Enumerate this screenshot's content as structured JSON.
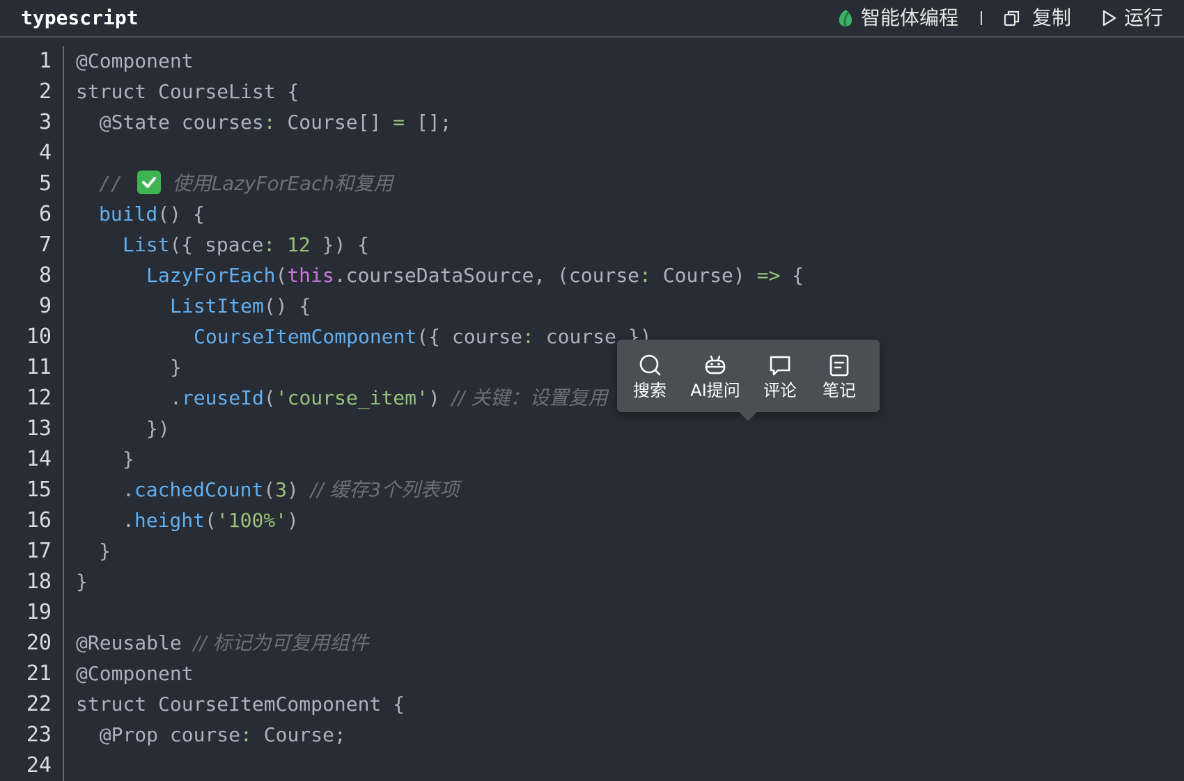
{
  "header": {
    "language": "typescript",
    "actions": [
      {
        "label": "智能体编程",
        "icon": "agent-logo-icon"
      },
      {
        "label": "复制",
        "icon": "copy-icon"
      },
      {
        "label": "运行",
        "icon": "play-icon"
      }
    ]
  },
  "editor": {
    "line_numbers": [
      "1",
      "2",
      "3",
      "4",
      "5",
      "6",
      "7",
      "8",
      "9",
      "10",
      "11",
      "12",
      "13",
      "14",
      "15",
      "16",
      "17",
      "18",
      "19",
      "20",
      "21",
      "22",
      "23",
      "24"
    ],
    "code": {
      "l1": "@Component",
      "l2": "struct CourseList {",
      "l3_a": "  @State courses",
      "l3_b": ":",
      "l3_c": " Course[] ",
      "l3_d": "=",
      "l3_e": " [];",
      "l5_a": "// ",
      "l5_b": " 使用LazyForEach和复用",
      "l6_a": "build",
      "l6_b": "() {",
      "l7_a": "List",
      "l7_b": "({ space",
      "l7_c": ":",
      "l7_d": "12",
      "l7_e": " }) {",
      "l8_a": "LazyForEach",
      "l8_b": "(",
      "l8_c": "this",
      "l8_d": ".courseDataSource, (course",
      "l8_e": ":",
      "l8_f": " Course) ",
      "l8_g": "=>",
      "l8_h": " {",
      "l9_a": "ListItem",
      "l9_b": "() {",
      "l10_a": "CourseItemComponent",
      "l10_b": "({ course",
      "l10_c": ":",
      "l10_d": " course })",
      "l11": "}",
      "l12_a": ".",
      "l12_b": "reuseId",
      "l12_c": "(",
      "l12_d": "'course_item'",
      "l12_e": ") ",
      "l12_f": "// 关键：设置复用",
      "l13": "})",
      "l14": "}",
      "l15_a": ".",
      "l15_b": "cachedCount",
      "l15_c": "(",
      "l15_d": "3",
      "l15_e": ") ",
      "l15_f": "// 缓存3个列表项",
      "l16_a": ".",
      "l16_b": "height",
      "l16_c": "(",
      "l16_d": "'100%'",
      "l16_e": ")",
      "l17": "}",
      "l18": "}",
      "l20_a": "@Reusable ",
      "l20_b": "// 标记为可复用组件",
      "l21": "@Component",
      "l22": "struct CourseItemComponent {",
      "l23_a": "  @Prop course",
      "l23_b": ":",
      "l23_c": " Course;"
    }
  },
  "popup": {
    "items": [
      {
        "label": "搜索",
        "icon": "search-icon"
      },
      {
        "label": "AI提问",
        "icon": "robot-icon"
      },
      {
        "label": "评论",
        "icon": "comment-icon"
      },
      {
        "label": "笔记",
        "icon": "note-icon"
      }
    ]
  },
  "colors": {
    "background": "#282c34",
    "function": "#61afef",
    "string": "#98c379",
    "keyword": "#c678dd",
    "comment": "#6a6f79",
    "popup_bg": "#4a4e55"
  }
}
